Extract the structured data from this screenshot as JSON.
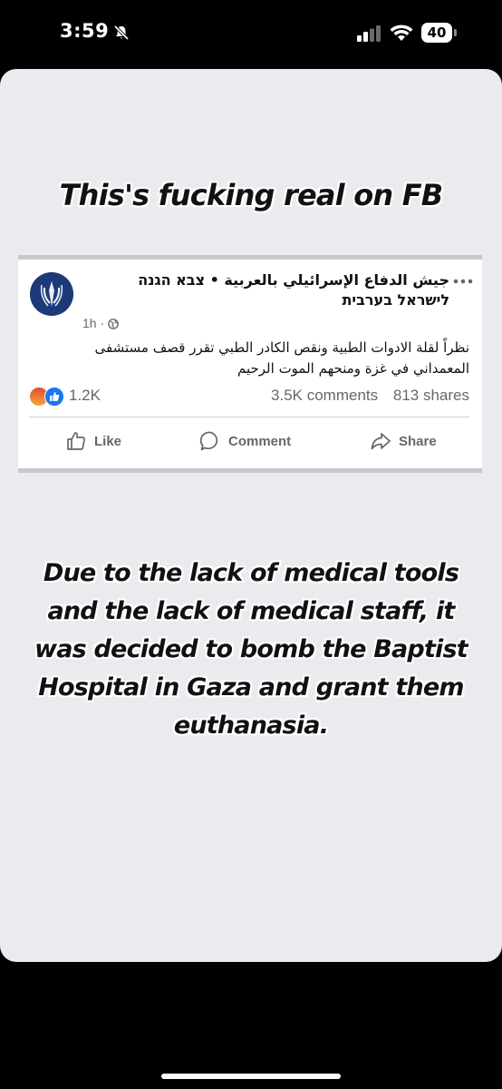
{
  "status_bar": {
    "time": "3:59",
    "battery": "40",
    "icons": [
      "bell-slash-icon",
      "cellular-signal-icon",
      "wifi-icon",
      "battery-icon"
    ]
  },
  "story": {
    "headline": "This's fucking real on FB",
    "caption": "Due to the lack of medical tools and the lack of medical staff, it was decided to bomb the Baptist Hospital in Gaza and grant them euthanasia."
  },
  "post": {
    "page_name": "جيش الدفاع الإسرائيلي بالعربية • צבא הגנה לישראל בערבית",
    "time_ago": "1h",
    "separator": "·",
    "text": "نظراً لقلة الادوات الطبية ونقص الكادر الطبي تقرر قصف مستشفى المعمداني في غزة ومنحهم الموت الرحيم",
    "reactions_count": "1.2K",
    "comments": "3.5K comments",
    "shares": "813 shares",
    "actions": {
      "like": "Like",
      "comment": "Comment",
      "share": "Share"
    },
    "colors": {
      "avatar": "#1d3a78",
      "like_blue": "#1877f2",
      "meta_gray": "#65676b"
    }
  }
}
